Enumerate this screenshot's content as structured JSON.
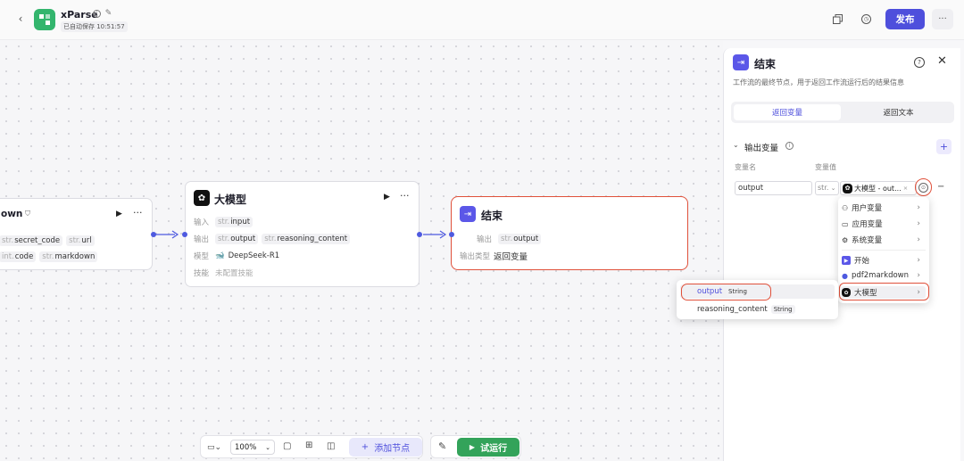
{
  "header": {
    "back_icon": "chevron-left-icon",
    "app_name": "xParse",
    "autosave": "已自动保存 10:51:57",
    "publish": "发布",
    "more": "···"
  },
  "node_markdown": {
    "title": "own",
    "fields": [
      {
        "type": "str.",
        "name": "secret_code"
      },
      {
        "type": "str.",
        "name": "url"
      },
      {
        "type": "int.",
        "name": "code"
      },
      {
        "type": "str.",
        "name": "markdown"
      }
    ]
  },
  "node_llm": {
    "title": "大模型",
    "input_label": "输入",
    "input_type": "str.",
    "input_name": "input",
    "output_label": "输出",
    "output1_type": "str.",
    "output1": "output",
    "output2_type": "str.",
    "output2": "reasoning_content",
    "model_label": "模型",
    "model": "DeepSeek-R1",
    "skill_label": "技能",
    "skill": "未配置技能"
  },
  "node_end": {
    "title": "结束",
    "output_label": "输出",
    "output_type": "str.",
    "output": "output",
    "otype_label": "输出类型",
    "otype": "返回变量"
  },
  "panel": {
    "title": "结束",
    "desc": "工作流的最终节点，用于返回工作流运行后的结果信息",
    "tab_active": "返回变量",
    "tab_other": "返回文本",
    "section": "输出变量",
    "col_name": "变量名",
    "col_value": "变量值",
    "var_name": "output",
    "var_type": "str.",
    "var_value": "大模型 - out...",
    "remove": "−",
    "add": "+"
  },
  "menu": {
    "items": [
      "用户变量",
      "应用变量",
      "系统变量",
      "开始",
      "pdf2markdown",
      "大模型"
    ]
  },
  "submenu": {
    "items": [
      {
        "name": "output",
        "type": "String"
      },
      {
        "name": "reasoning_content",
        "type": "String"
      }
    ]
  },
  "toolbar": {
    "zoom": "100%",
    "add_node": "添加节点",
    "run": "试运行"
  }
}
